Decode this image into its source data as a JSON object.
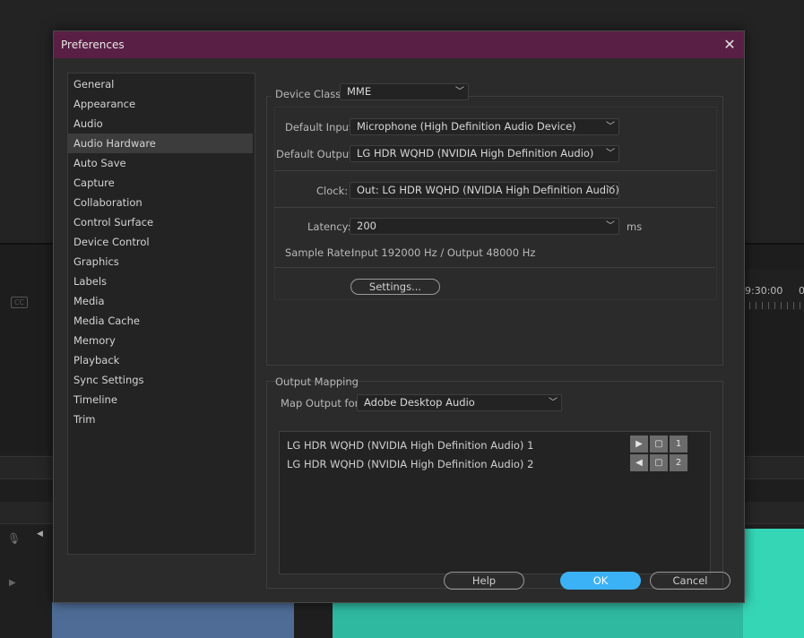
{
  "background": {
    "ruler_time": "9:30:00",
    "ruler_time_partial": "0"
  },
  "dialog": {
    "title": "Preferences",
    "categories": [
      "General",
      "Appearance",
      "Audio",
      "Audio Hardware",
      "Auto Save",
      "Capture",
      "Collaboration",
      "Control Surface",
      "Device Control",
      "Graphics",
      "Labels",
      "Media",
      "Media Cache",
      "Memory",
      "Playback",
      "Sync Settings",
      "Timeline",
      "Trim"
    ],
    "selected_category": "Audio Hardware",
    "device_class": {
      "label": "Device Class:",
      "value": "MME"
    },
    "default_input": {
      "label": "Default Input:",
      "value": "Microphone (High Definition Audio Device)"
    },
    "default_output": {
      "label": "Default Output:",
      "value": "LG HDR WQHD (NVIDIA High Definition Audio)"
    },
    "clock": {
      "label": "Clock:",
      "value": "Out: LG HDR WQHD (NVIDIA High Definition Audio)"
    },
    "latency": {
      "label": "Latency:",
      "value": "200",
      "unit": "ms"
    },
    "sample_rate": {
      "label": "Sample Rate:",
      "value": "Input 192000 Hz / Output 48000 Hz"
    },
    "settings_button": "Settings...",
    "output_mapping": {
      "title": "Output Mapping",
      "map_label": "Map Output for:",
      "map_value": "Adobe Desktop Audio",
      "rows": [
        {
          "name": "LG HDR WQHD (NVIDIA High Definition Audio) 1",
          "channel": "1"
        },
        {
          "name": "LG HDR WQHD (NVIDIA High Definition Audio) 2",
          "channel": "2"
        }
      ]
    },
    "buttons": {
      "help": "Help",
      "ok": "OK",
      "cancel": "Cancel"
    }
  },
  "colors": {
    "titlebar": "#5a1f45",
    "ok_button": "#3bb2f5",
    "clip_teal": "#2fb9a0",
    "clip_blue": "#4e6c95"
  }
}
